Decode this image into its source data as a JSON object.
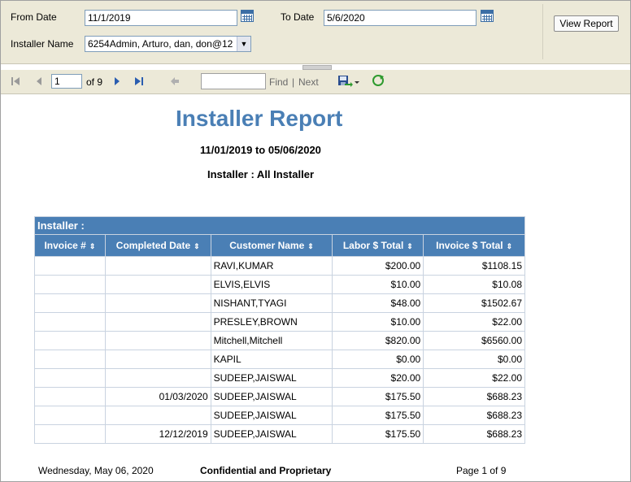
{
  "params": {
    "from_date_label": "From Date",
    "from_date_value": "11/1/2019",
    "to_date_label": "To Date",
    "to_date_value": "5/6/2020",
    "installer_label": "Installer Name",
    "installer_value": "6254Admin, Arturo, dan, don@12",
    "view_report_label": "View Report"
  },
  "toolbar": {
    "page_value": "1",
    "page_of": "of 9",
    "find_label": "Find",
    "separator": "|",
    "next_label": "Next",
    "find_value": ""
  },
  "report": {
    "title": "Installer Report",
    "date_range": "11/01/2019 to 05/06/2020",
    "installer_line": "Installer : All Installer",
    "group_header": "Installer :",
    "columns": [
      "Invoice #",
      "Completed Date",
      "Customer Name",
      "Labor $ Total",
      "Invoice $ Total"
    ],
    "rows": [
      {
        "invoice": "",
        "completed": "",
        "customer": "RAVI,KUMAR",
        "labor": "$200.00",
        "total": "$1108.15"
      },
      {
        "invoice": "",
        "completed": "",
        "customer": "ELVIS,ELVIS",
        "labor": "$10.00",
        "total": "$10.08"
      },
      {
        "invoice": "",
        "completed": "",
        "customer": "NISHANT,TYAGI",
        "labor": "$48.00",
        "total": "$1502.67"
      },
      {
        "invoice": "",
        "completed": "",
        "customer": "PRESLEY,BROWN",
        "labor": "$10.00",
        "total": "$22.00"
      },
      {
        "invoice": "",
        "completed": "",
        "customer": "Mitchell,Mitchell",
        "labor": "$820.00",
        "total": "$6560.00"
      },
      {
        "invoice": "",
        "completed": "",
        "customer": "KAPIL",
        "labor": "$0.00",
        "total": "$0.00"
      },
      {
        "invoice": "",
        "completed": "",
        "customer": "SUDEEP,JAISWAL",
        "labor": "$20.00",
        "total": "$22.00"
      },
      {
        "invoice": "",
        "completed": "01/03/2020",
        "customer": "SUDEEP,JAISWAL",
        "labor": "$175.50",
        "total": "$688.23"
      },
      {
        "invoice": "",
        "completed": "",
        "customer": "SUDEEP,JAISWAL",
        "labor": "$175.50",
        "total": "$688.23"
      },
      {
        "invoice": "",
        "completed": "12/12/2019",
        "customer": "SUDEEP,JAISWAL",
        "labor": "$175.50",
        "total": "$688.23"
      }
    ]
  },
  "footer": {
    "date": "Wednesday, May 06, 2020",
    "confidential": "Confidential and Proprietary",
    "page": "Page  1 of 9"
  },
  "colors": {
    "accent": "#4a7fb5",
    "panel": "#ece9d8"
  },
  "icons": [
    "calendar-icon",
    "first-page-icon",
    "previous-page-icon",
    "next-page-icon",
    "last-page-icon",
    "back-icon",
    "export-save-icon",
    "refresh-icon",
    "sort-icon"
  ]
}
